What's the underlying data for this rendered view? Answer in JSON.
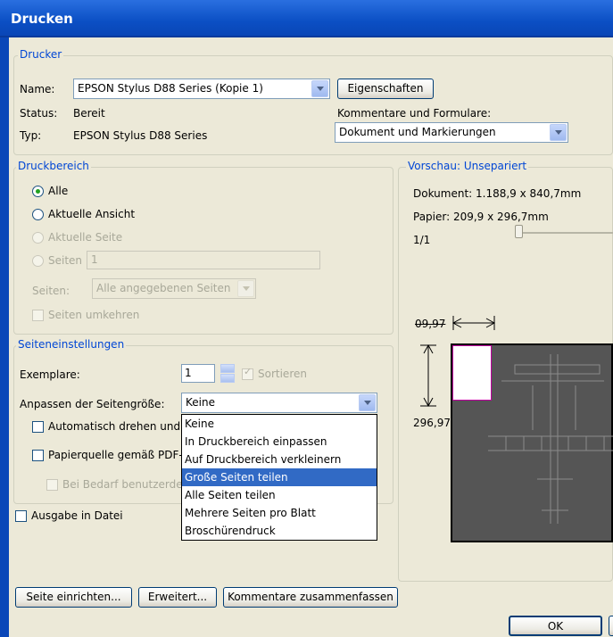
{
  "window": {
    "title": "Drucken"
  },
  "printer": {
    "group_label": "Drucker",
    "name_label": "Name:",
    "name_value": "EPSON Stylus D88 Series (Kopie 1)",
    "properties_button": "Eigenschaften",
    "status_label": "Status:",
    "status_value": "Bereit",
    "type_label": "Typ:",
    "type_value": "EPSON Stylus D88 Series",
    "comments_label": "Kommentare und Formulare:",
    "comments_value": "Dokument und Markierungen"
  },
  "print_range": {
    "group_label": "Druckbereich",
    "all": "Alle",
    "current_view": "Aktuelle Ansicht",
    "current_page": "Aktuelle Seite",
    "pages": "Seiten",
    "pages_value": "1",
    "subset_label": "Seiten:",
    "subset_value": "Alle angegebenen Seiten",
    "reverse": "Seiten umkehren"
  },
  "page_settings": {
    "group_label": "Seiteneinstellungen",
    "copies_label": "Exemplare:",
    "copies_value": "1",
    "collate": "Sortieren",
    "scaling_label": "Anpassen der Seitengröße:",
    "scaling_value": "Keine",
    "auto_rotate": "Automatisch drehen und",
    "paper_source": "Papierquelle gemäß PDF-",
    "custom_paper": "Bei Bedarf benutzerde",
    "scaling_options": [
      "Keine",
      "In Druckbereich einpassen",
      "Auf Druckbereich verkleinern",
      "Große Seiten teilen",
      "Alle Seiten teilen",
      "Mehrere Seiten pro Blatt",
      "Broschürendruck"
    ],
    "highlighted_index": 3
  },
  "output_file": "Ausgabe in Datei",
  "preview": {
    "group_label": "Vorschau: Unsepariert",
    "document": "Dokument: 1.188,9 x 840,7mm",
    "paper": "Papier: 209,9 x 296,7mm",
    "page_counter": "1/1",
    "width_dim": "09,97",
    "height_dim": "296,97"
  },
  "buttons": {
    "page_setup": "Seite einrichten...",
    "advanced": "Erweitert...",
    "summarize": "Kommentare zusammenfassen",
    "ok": "OK"
  }
}
